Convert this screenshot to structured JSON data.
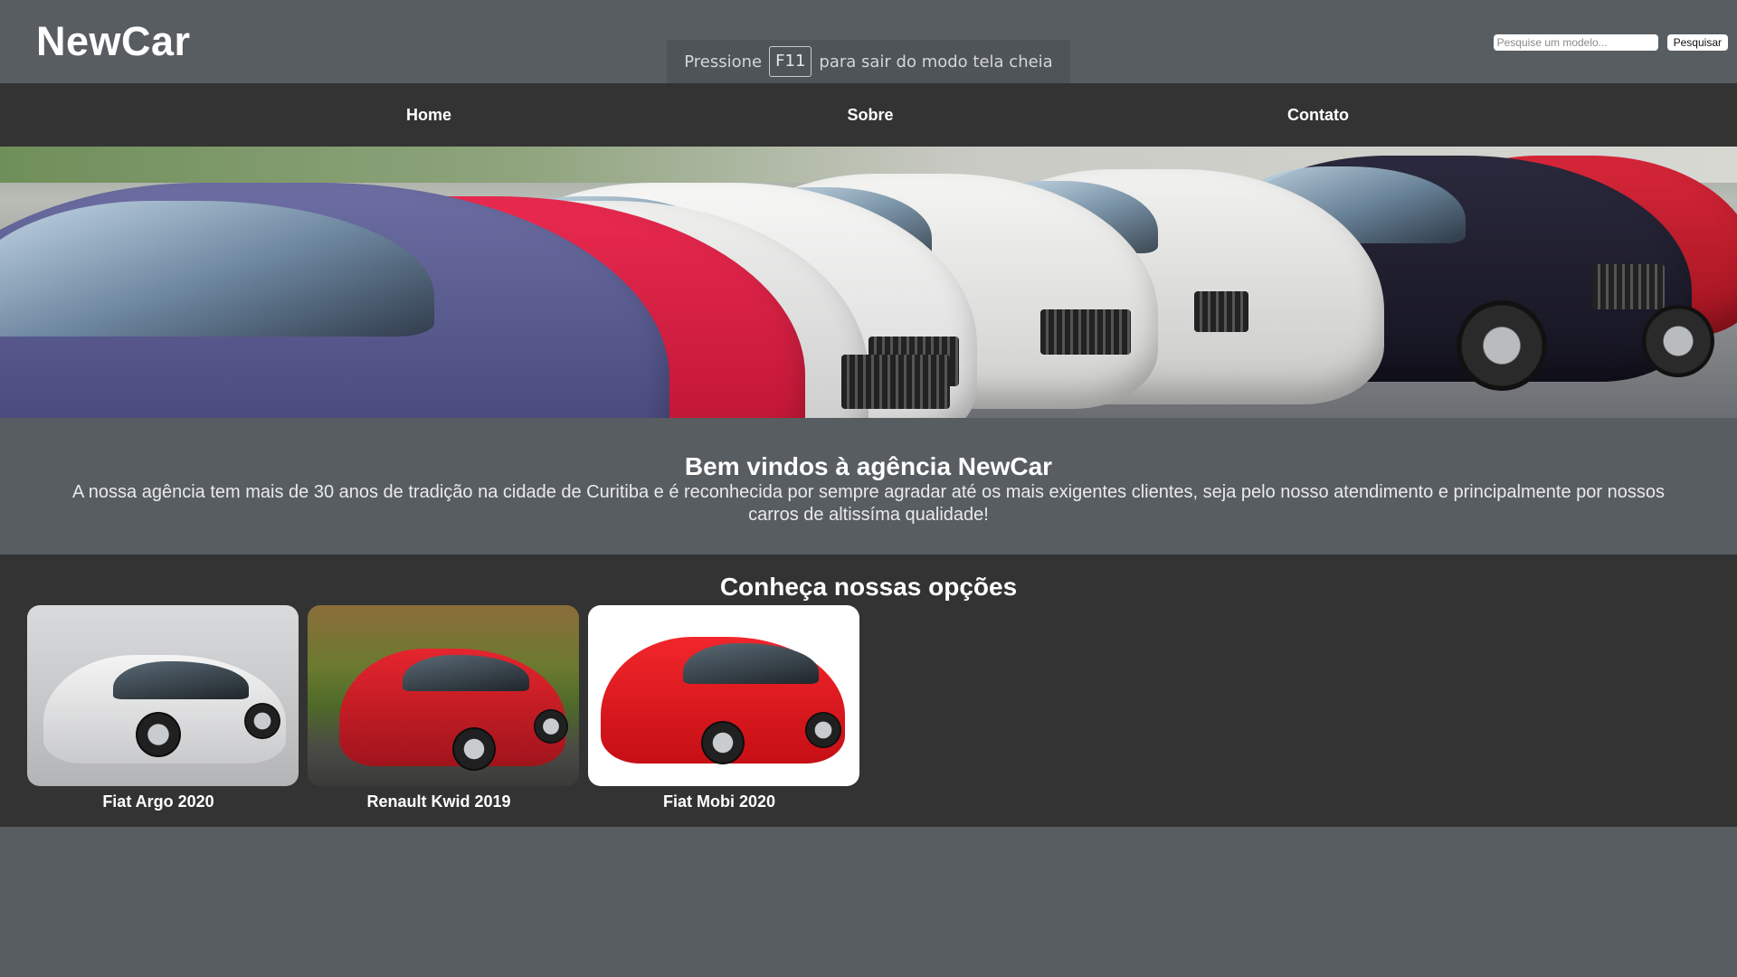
{
  "header": {
    "brand": "NewCar",
    "fullscreen_hint": {
      "before": "Pressione",
      "key": "F11",
      "after": "para sair do modo tela cheia"
    },
    "search": {
      "placeholder": "Pesquise um modelo...",
      "value": "",
      "button_label": "Pesquisar"
    }
  },
  "nav": {
    "items": [
      {
        "label": "Home"
      },
      {
        "label": "Sobre"
      },
      {
        "label": "Contato"
      }
    ]
  },
  "hero": {
    "image_icon": "car-lot-photo"
  },
  "welcome": {
    "title": "Bem vindos à agência NewCar",
    "text": "A nossa agência tem mais de 30 anos de tradição na cidade de Curitiba e é reconhecida por sempre agradar até os mais exigentes clientes, seja pelo nosso atendimento e principalmente por nossos carros de altissíma qualidade!"
  },
  "options": {
    "title": "Conheça nossas opções",
    "cars": [
      {
        "name": "Fiat Argo 2020",
        "color": "#dcdde0"
      },
      {
        "name": "Renault Kwid 2019",
        "color": "#d11a23"
      },
      {
        "name": "Fiat Mobi 2020",
        "color": "#e0161c"
      }
    ]
  },
  "colors": {
    "header_bg": "#585d62",
    "nav_bg": "#333333",
    "text": "#ffffff"
  }
}
